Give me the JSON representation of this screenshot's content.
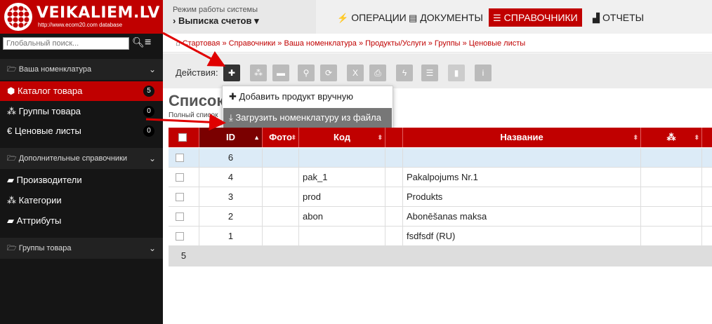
{
  "logo": {
    "title": "VEIKALIEM.LV",
    "subtitle": "http://www.ecom20.com database"
  },
  "mode": {
    "label": "Режим работы системы",
    "value": "› Выписка счетов ▾"
  },
  "nav": [
    {
      "icon": "bolt-icon",
      "label": "ОПЕРАЦИИ"
    },
    {
      "icon": "document-icon",
      "label": "ДОКУМЕНТЫ"
    },
    {
      "icon": "database-icon",
      "label": "СПРАВОЧНИКИ",
      "active": true
    },
    {
      "icon": "chart-icon",
      "label": "ОТЧЕТЫ"
    }
  ],
  "search": {
    "placeholder": "Глобальный поиск..."
  },
  "sidebar": {
    "sections": [
      {
        "label": "Ваша номенклатура"
      },
      {
        "label": "Дополнительные справочники"
      },
      {
        "label": "Группы товара"
      }
    ],
    "items": [
      {
        "label": "Каталог товара",
        "badge": "5"
      },
      {
        "label": "Группы товара",
        "badge": "0"
      },
      {
        "label": "Ценовые листы",
        "badge": "0"
      },
      {
        "label": "Производители"
      },
      {
        "label": "Категории"
      },
      {
        "label": "Аттрибуты"
      }
    ]
  },
  "breadcrumb": "Стартовая  »  Справочники  »  Ваша номенклатура  »  Продукты/Услуги  »  Группы  »  Ценовые листы",
  "actions": {
    "label": "Действия:"
  },
  "page": {
    "title": "Список",
    "subtitle": "Полный список"
  },
  "dropdown": {
    "items": [
      {
        "label": "Добавить продукт вручную"
      },
      {
        "label": "Загрузить номенклатуру из файла"
      }
    ]
  },
  "table": {
    "headers": {
      "id": "ID",
      "photo": "Фото",
      "code": "Код",
      "name": "Название"
    },
    "rows": [
      {
        "id": "6",
        "code": "",
        "name": ""
      },
      {
        "id": "4",
        "code": "pak_1",
        "name": "Pakalpojums Nr.1"
      },
      {
        "id": "3",
        "code": "prod",
        "name": "Produkts"
      },
      {
        "id": "2",
        "code": "abon",
        "name": "Abonēšanas maksa"
      },
      {
        "id": "1",
        "code": "",
        "name": "fsdfsdf (RU)"
      }
    ],
    "footer_count": "5"
  },
  "colors": {
    "brand": "#c00000",
    "sidebar": "#151515"
  }
}
